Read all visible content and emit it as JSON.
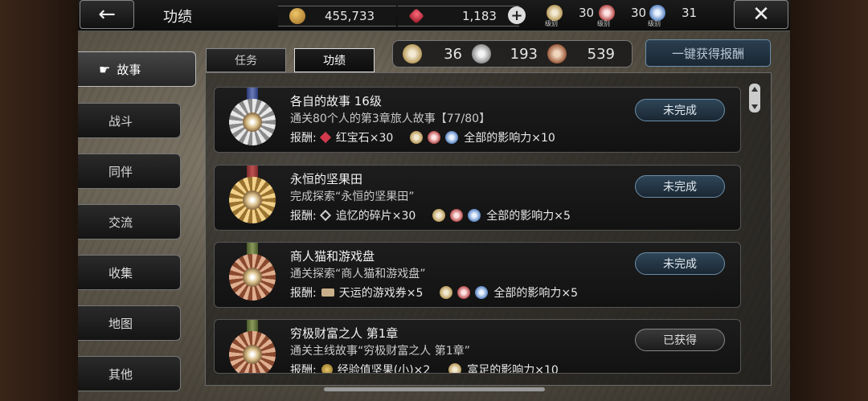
{
  "header": {
    "title": "功绩",
    "back_icon": "←",
    "close_icon": "✕",
    "coins": "455,733",
    "gems": "1,183",
    "plus": "+",
    "levels": [
      {
        "value": "30",
        "caption": "级别"
      },
      {
        "value": "30",
        "caption": "级别"
      },
      {
        "value": "31",
        "caption": "级别"
      }
    ]
  },
  "sidebar": {
    "items": [
      {
        "label": "故事",
        "active": true
      },
      {
        "label": "战斗"
      },
      {
        "label": "同伴"
      },
      {
        "label": "交流"
      },
      {
        "label": "收集"
      },
      {
        "label": "地图"
      },
      {
        "label": "其他"
      }
    ],
    "pointer_icon": "☛"
  },
  "tabs": [
    {
      "label": "任务"
    },
    {
      "label": "功绩",
      "active": true
    }
  ],
  "summary": {
    "gold": "36",
    "silver": "193",
    "bronze": "539"
  },
  "claim_all_label": "一键获得报酬",
  "achievements": [
    {
      "title": "各自的故事 16级",
      "desc": "通关80个人的第3章旅人故事【77/80】",
      "reward_label": "报酬:",
      "reward_item": "红宝石×30",
      "reward_influence": "全部的影响力×10",
      "status": "未完成"
    },
    {
      "title": "永恒的坚果田",
      "desc": "完成探索“永恒的坚果田”",
      "reward_label": "报酬:",
      "reward_item": "追忆的碎片×30",
      "reward_influence": "全部的影响力×5",
      "status": "未完成"
    },
    {
      "title": "商人猫和游戏盘",
      "desc": "通关探索“商人猫和游戏盘”",
      "reward_label": "报酬:",
      "reward_item": "天运的游戏券×5",
      "reward_influence": "全部的影响力×5",
      "status": "未完成"
    },
    {
      "title": "穷极财富之人 第1章",
      "desc": "通关主线故事“穷极财富之人 第1章”",
      "reward_label": "报酬:",
      "reward_item": "经验值坚果(小)×2",
      "reward_influence": "富足的影响力×10",
      "status": "已获得"
    }
  ]
}
